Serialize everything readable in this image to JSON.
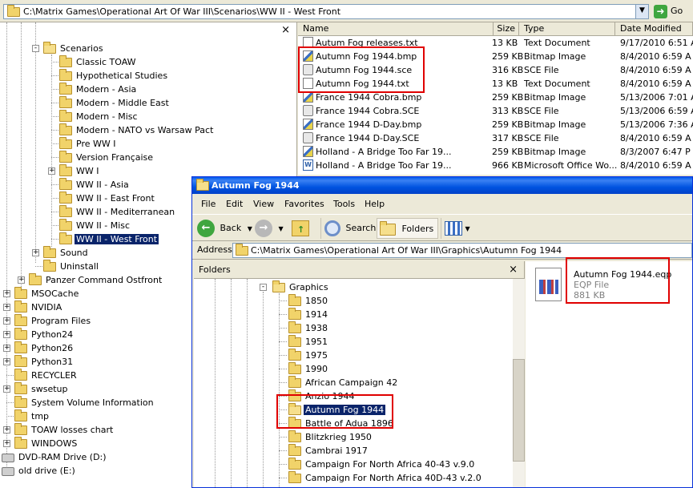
{
  "top_address": {
    "path": "C:\\Matrix Games\\Operational Art Of War III\\Scenarios\\WW II - West Front",
    "go": "Go"
  },
  "left_tree": {
    "close": "×",
    "items": [
      {
        "label": "Scenarios",
        "level": 3
      },
      {
        "label": "Classic TOAW",
        "level": 4
      },
      {
        "label": "Hypothetical Studies",
        "level": 4
      },
      {
        "label": "Modern - Asia",
        "level": 4
      },
      {
        "label": "Modern - Middle East",
        "level": 4
      },
      {
        "label": "Modern - Misc",
        "level": 4
      },
      {
        "label": "Modern - NATO vs Warsaw Pact",
        "level": 4
      },
      {
        "label": "Pre WW I",
        "level": 4
      },
      {
        "label": "Version Française",
        "level": 4
      },
      {
        "label": "WW I",
        "level": 4
      },
      {
        "label": "WW II - Asia",
        "level": 4
      },
      {
        "label": "WW II - East Front",
        "level": 4
      },
      {
        "label": "WW II - Mediterranean",
        "level": 4
      },
      {
        "label": "WW II - Misc",
        "level": 4
      },
      {
        "label": "WW II - West Front",
        "level": 4
      },
      {
        "label": "Sound",
        "level": 3
      },
      {
        "label": "Uninstall",
        "level": 3
      },
      {
        "label": "Panzer Command Ostfront",
        "level": 2
      },
      {
        "label": "MSOCache",
        "level": 1
      },
      {
        "label": "NVIDIA",
        "level": 1
      },
      {
        "label": "Program Files",
        "level": 1
      },
      {
        "label": "Python24",
        "level": 1
      },
      {
        "label": "Python26",
        "level": 1
      },
      {
        "label": "Python31",
        "level": 1
      },
      {
        "label": "RECYCLER",
        "level": 1
      },
      {
        "label": "swsetup",
        "level": 1
      },
      {
        "label": "System Volume Information",
        "level": 1
      },
      {
        "label": "tmp",
        "level": 1
      },
      {
        "label": "TOAW losses chart",
        "level": 1
      },
      {
        "label": "WINDOWS",
        "level": 1
      },
      {
        "label": "DVD-RAM Drive (D:)",
        "level": 0
      },
      {
        "label": "old drive (E:)",
        "level": 0
      }
    ]
  },
  "file_list": {
    "headers": [
      "Name",
      "Size",
      "Type",
      "Date Modified"
    ],
    "rows": [
      {
        "name": "Autum Fog releases.txt",
        "size": "13 KB",
        "type": "Text Document",
        "date": "9/17/2010 6:51 A"
      },
      {
        "name": "Autumn Fog 1944.bmp",
        "size": "259 KB",
        "type": "Bitmap Image",
        "date": "8/4/2010 6:59 A"
      },
      {
        "name": "Autumn Fog 1944.sce",
        "size": "316 KB",
        "type": "SCE File",
        "date": "8/4/2010 6:59 A"
      },
      {
        "name": "Autumn Fog 1944.txt",
        "size": "13 KB",
        "type": "Text Document",
        "date": "8/4/2010 6:59 A"
      },
      {
        "name": "France 1944 Cobra.bmp",
        "size": "259 KB",
        "type": "Bitmap Image",
        "date": "5/13/2006 7:01 A"
      },
      {
        "name": "France 1944 Cobra.SCE",
        "size": "313 KB",
        "type": "SCE File",
        "date": "5/13/2006 6:59 A"
      },
      {
        "name": "France 1944 D-Day.bmp",
        "size": "259 KB",
        "type": "Bitmap Image",
        "date": "5/13/2006 7:36 A"
      },
      {
        "name": "France 1944 D-Day.SCE",
        "size": "317 KB",
        "type": "SCE File",
        "date": "8/4/2010 6:59 A"
      },
      {
        "name": "Holland - A Bridge Too Far 19...",
        "size": "259 KB",
        "type": "Bitmap Image",
        "date": "8/3/2007 6:47 P"
      },
      {
        "name": "Holland - A Bridge Too Far 19...",
        "size": "966 KB",
        "type": "Microsoft Office Wo...",
        "date": "8/4/2010 6:59 A"
      }
    ]
  },
  "window2": {
    "title": "Autumn Fog 1944",
    "menu": [
      "File",
      "Edit",
      "View",
      "Favorites",
      "Tools",
      "Help"
    ],
    "toolbar": {
      "back": "Back",
      "search": "Search",
      "folders": "Folders"
    },
    "address_label": "Address",
    "address": "C:\\Matrix Games\\Operational Art Of War III\\Graphics\\Autumn Fog 1944",
    "folders_header": "Folders",
    "folders_close": "×",
    "folders": [
      "Graphics",
      "1850",
      "1914",
      "1938",
      "1951",
      "1975",
      "1990",
      "African Campaign 42",
      "Anzio 1944",
      "Autumn Fog 1944",
      "Battle of Adua 1896",
      "Blitzkrieg 1950",
      "Cambrai 1917",
      "Campaign For North Africa 40-43 v.9.0",
      "Campaign For North Africa 40D-43 v.2.0"
    ],
    "file": {
      "name": "Autumn Fog 1944.eqp",
      "type": "EQP File",
      "size": "881 KB"
    }
  },
  "behind_fragment": [
    "13",
    "25"
  ]
}
